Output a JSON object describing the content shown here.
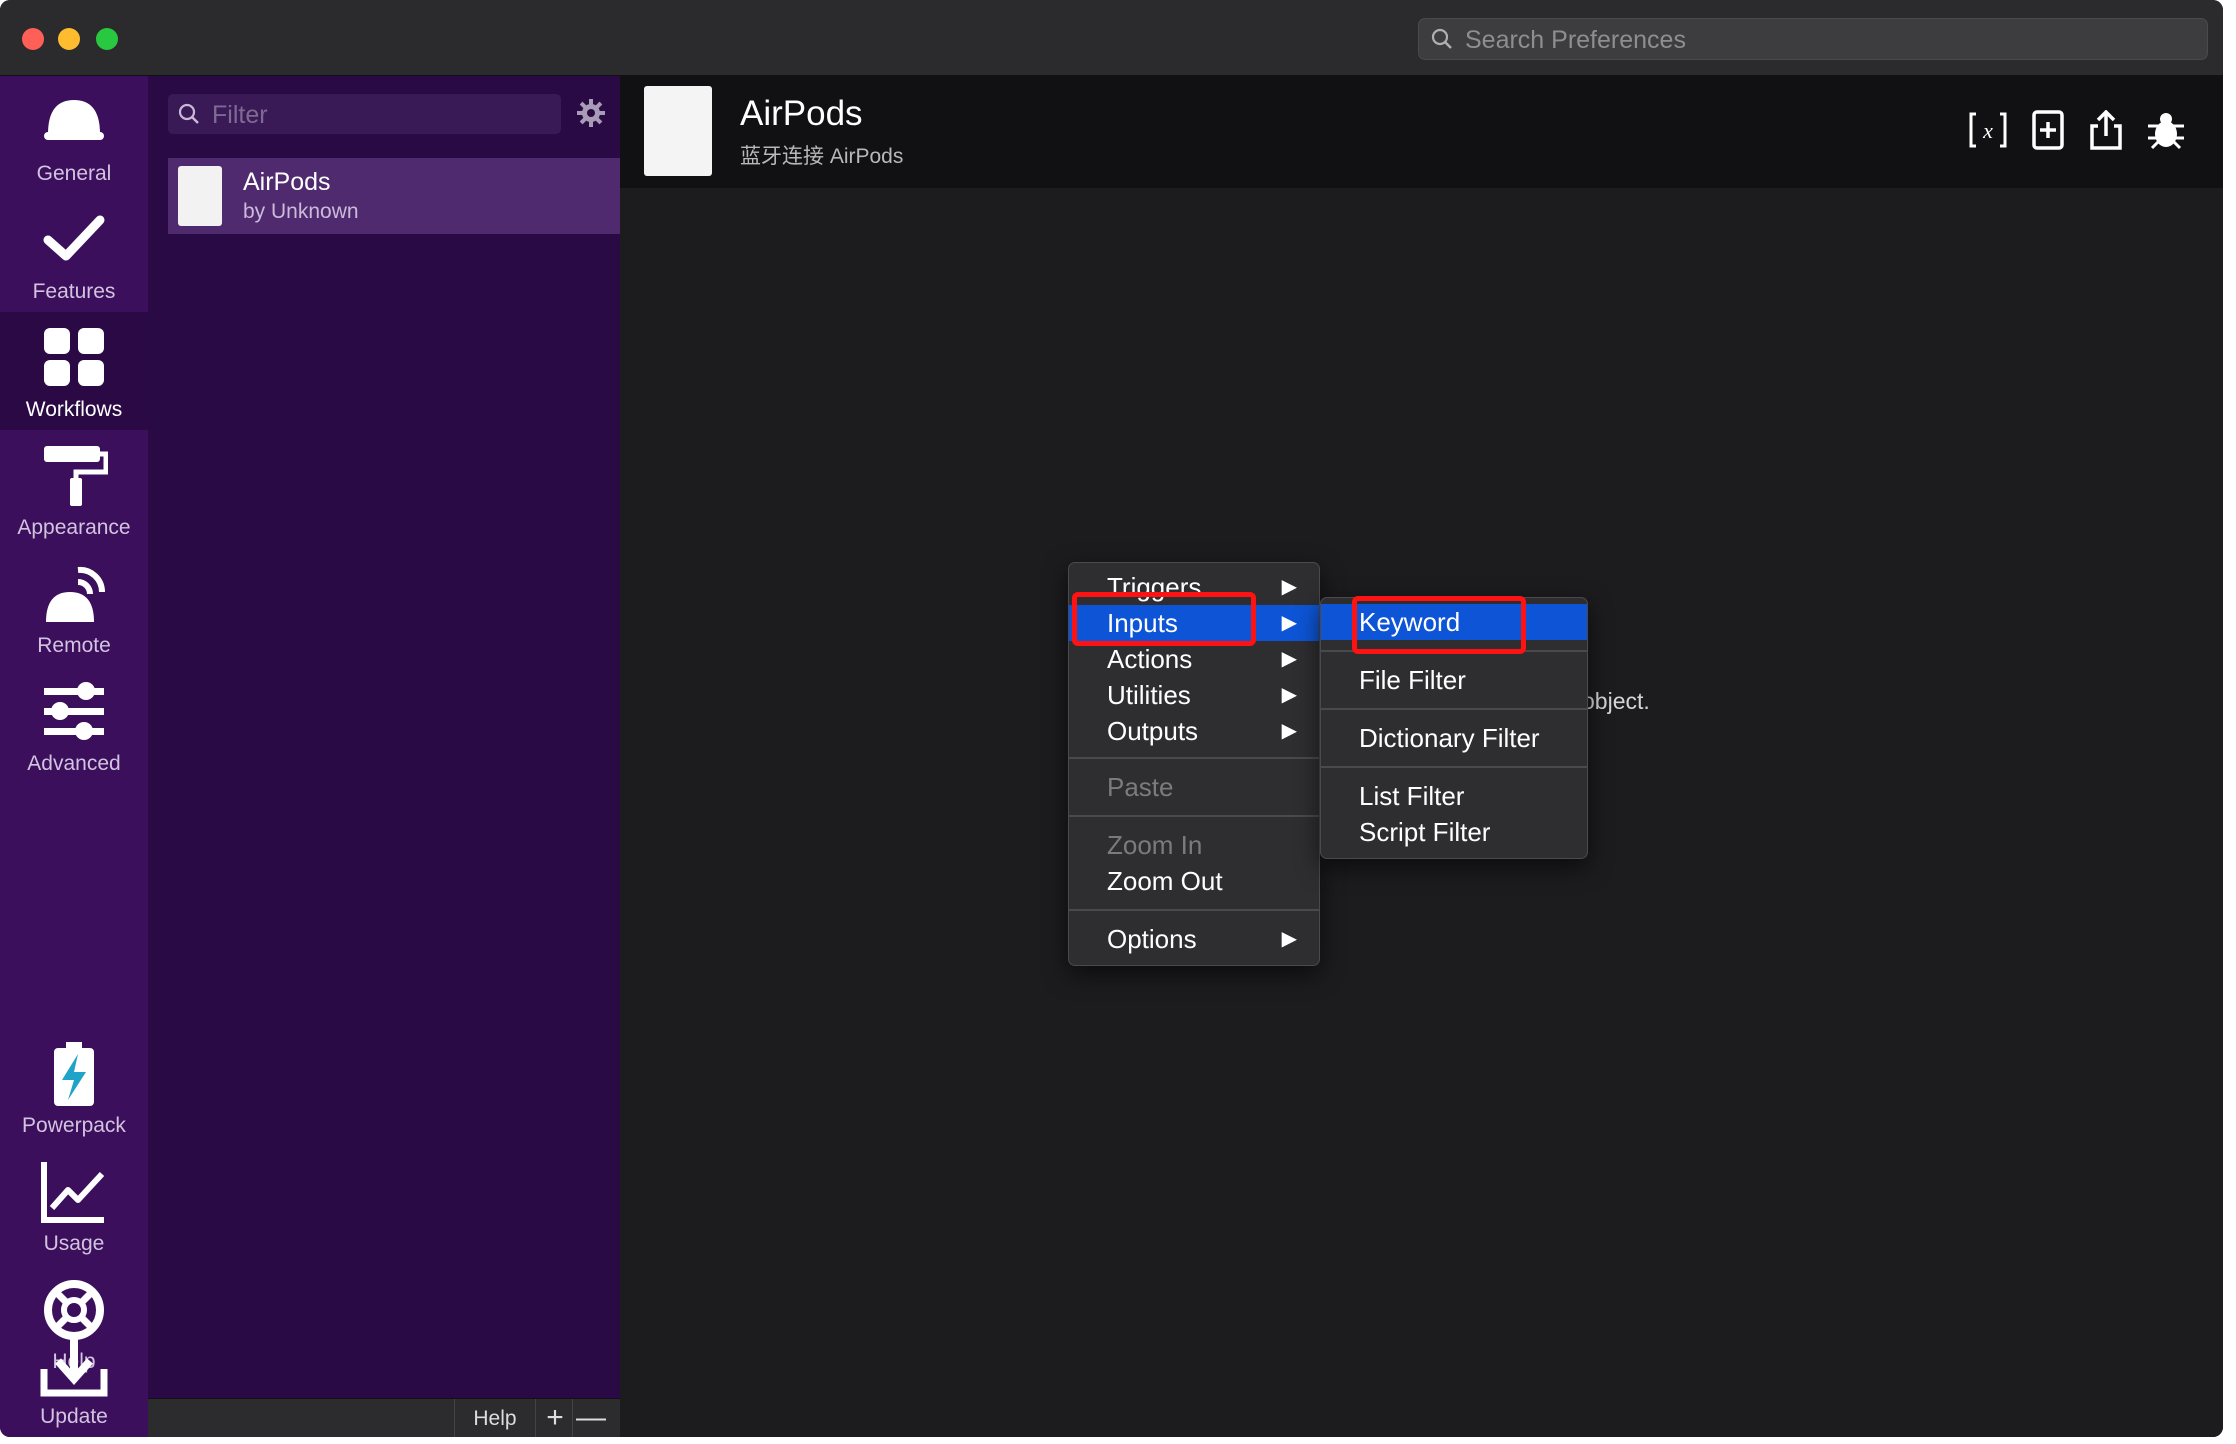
{
  "search_preferences": {
    "placeholder": "Search Preferences"
  },
  "nav": {
    "items": [
      {
        "label": "General",
        "icon": "bell-icon"
      },
      {
        "label": "Features",
        "icon": "checkmark-icon"
      },
      {
        "label": "Workflows",
        "icon": "grid-icon",
        "active": true
      },
      {
        "label": "Appearance",
        "icon": "paint-roller-icon"
      },
      {
        "label": "Remote",
        "icon": "remote-icon"
      },
      {
        "label": "Advanced",
        "icon": "sliders-icon"
      },
      {
        "label": "Powerpack",
        "icon": "battery-bolt-icon"
      },
      {
        "label": "Usage",
        "icon": "chart-icon"
      },
      {
        "label": "Help",
        "icon": "lifebuoy-icon"
      },
      {
        "label": "Update",
        "icon": "download-icon"
      }
    ]
  },
  "workflow_list": {
    "filter_placeholder": "Filter",
    "items": [
      {
        "title": "AirPods",
        "author": "by Unknown"
      }
    ],
    "bottom": {
      "help": "Help",
      "add": "+",
      "remove": "—"
    }
  },
  "workflow": {
    "title": "AirPods",
    "subtitle": "蓝牙连接 AirPods",
    "canvas_text": "object."
  },
  "context_menu": {
    "items": [
      {
        "label": "Triggers",
        "submenu": true
      },
      {
        "label": "Inputs",
        "submenu": true,
        "highlighted": true
      },
      {
        "label": "Actions",
        "submenu": true
      },
      {
        "label": "Utilities",
        "submenu": true
      },
      {
        "label": "Outputs",
        "submenu": true
      },
      {
        "label": "Paste",
        "disabled": true
      },
      {
        "label": "Zoom In",
        "disabled": true
      },
      {
        "label": "Zoom Out"
      },
      {
        "label": "Options",
        "submenu": true
      }
    ],
    "arrow": "▶"
  },
  "inputs_submenu": {
    "items": [
      {
        "label": "Keyword",
        "highlighted": true
      },
      {
        "label": "File Filter"
      },
      {
        "label": "Dictionary Filter"
      },
      {
        "label": "List Filter"
      },
      {
        "label": "Script Filter"
      }
    ]
  },
  "colors": {
    "highlight": "#0d55d6",
    "nav_bg": "#3b0f5c",
    "annotation": "#ff1212"
  }
}
